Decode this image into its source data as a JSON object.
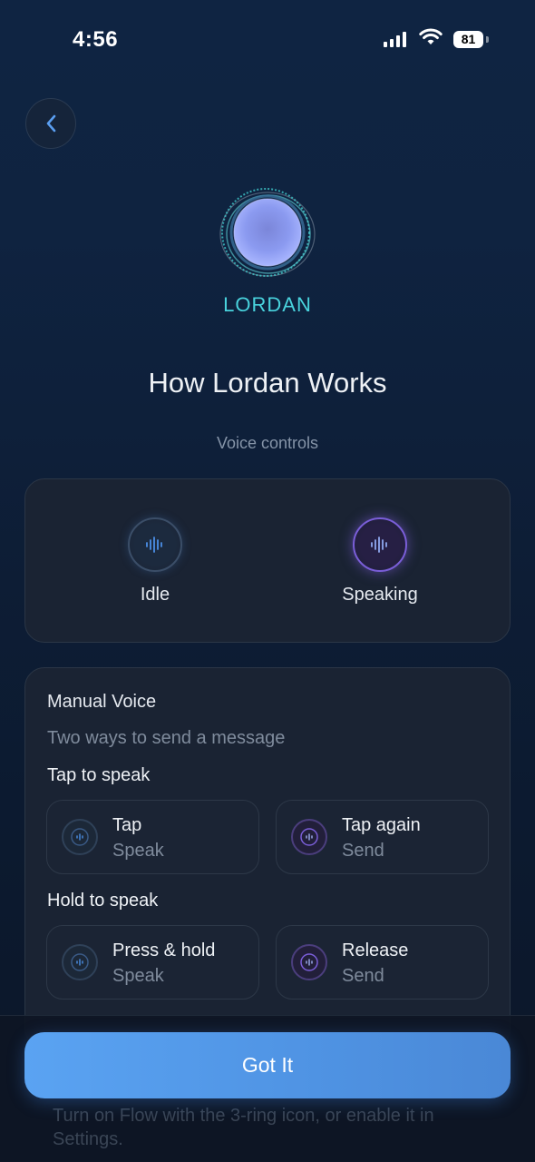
{
  "status_bar": {
    "time": "4:56",
    "battery": "81"
  },
  "brand": {
    "name": "LORDAN"
  },
  "header": {
    "title": "How Lordan Works",
    "subtitle": "Voice controls"
  },
  "voice_states": [
    {
      "label": "Idle"
    },
    {
      "label": "Speaking"
    }
  ],
  "manual": {
    "title": "Manual Voice",
    "subtitle": "Two ways to send a message",
    "tap_section": {
      "label": "Tap to speak",
      "tiles": [
        {
          "title": "Tap",
          "caption": "Speak"
        },
        {
          "title": "Tap again",
          "caption": "Send"
        }
      ]
    },
    "hold_section": {
      "label": "Hold to speak",
      "tiles": [
        {
          "title": "Press & hold",
          "caption": "Speak"
        },
        {
          "title": "Release",
          "caption": "Send"
        }
      ]
    }
  },
  "obscured_text": "Turn on Flow with the 3-ring icon, or enable it in Settings.",
  "footer": {
    "button_label": "Got It"
  },
  "colors": {
    "accent": "#4f93e3",
    "brand": "#49d3dd",
    "idle": "#3b6eaa",
    "speaking": "#7a5ed8"
  }
}
